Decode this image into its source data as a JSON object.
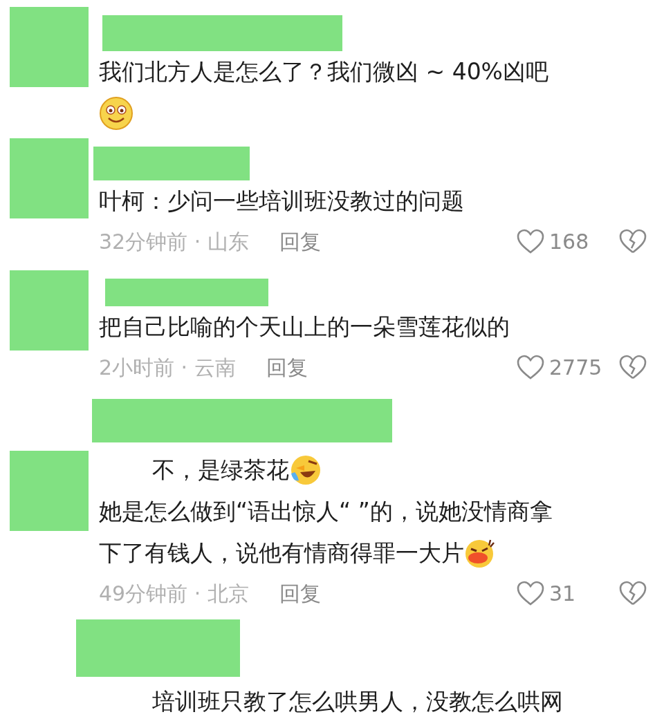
{
  "comments": [
    {
      "kind": "standard",
      "avatar": true,
      "lines": [
        {
          "text": "我们北方人是怎么了？我们微凶 ~ 40%凶吧",
          "kind": "plain",
          "indent": false
        },
        {
          "kind": "smile-emoji",
          "indent": false
        }
      ]
    },
    {
      "kind": "standard",
      "avatar": true,
      "lines": [
        {
          "text": "叶柯：少问一些培训班没教过的问题",
          "kind": "plain",
          "indent": false
        }
      ],
      "meta": {
        "time_location": "32分钟前 · 山东",
        "reply": "回复",
        "likes": "168"
      }
    },
    {
      "kind": "standard",
      "avatar": true,
      "lines": [
        {
          "text": "把自己比喻的个天山上的一朵雪莲花似的",
          "kind": "plain",
          "indent": false
        }
      ],
      "meta": {
        "time_location": "2小时前 · 云南",
        "reply": "回复",
        "likes": "2775"
      }
    },
    {
      "kind": "name-first",
      "avatar": true,
      "lines": [
        {
          "text": "不，是绿茶花",
          "kind": "laugh-emoji",
          "indent": true
        },
        {
          "text": "她是怎么做到“语出惊人“ ”的，说她没情商拿",
          "kind": "plain",
          "indent": false
        },
        {
          "text": "下了有钱人，说他有情商得罪一大片",
          "kind": "grin-emoji",
          "indent": false
        }
      ],
      "meta": {
        "time_location": "49分钟前 · 北京",
        "reply": "回复",
        "likes": "31"
      }
    },
    {
      "kind": "name-first",
      "avatar": false,
      "lines": [
        {
          "text": "培训班只教了怎么哄男人，没教怎么哄网",
          "kind": "plain",
          "indent": true
        }
      ]
    }
  ]
}
